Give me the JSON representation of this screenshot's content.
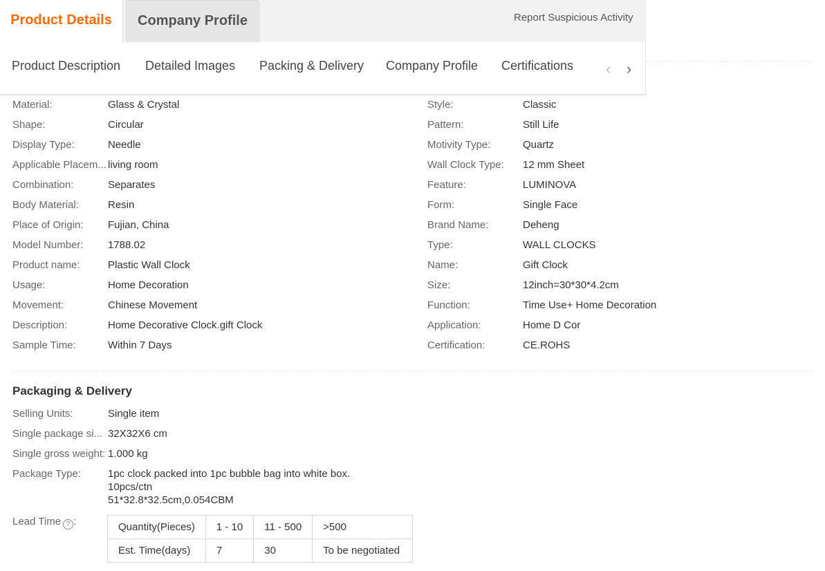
{
  "top_tabs": {
    "active": "Product Details",
    "inactive": "Company Profile",
    "report": "Report Suspicious Activity"
  },
  "subnav": {
    "items": [
      "Product Description",
      "Detailed Images",
      "Packing & Delivery",
      "Company Profile",
      "Certifications"
    ],
    "prev_icon": "chevron-left-icon",
    "next_icon": "chevron-right-icon"
  },
  "attributes_left": [
    {
      "label": "Material:",
      "value": "Glass & Crystal"
    },
    {
      "label": "Shape:",
      "value": "Circular"
    },
    {
      "label": "Display Type:",
      "value": "Needle"
    },
    {
      "label": "Applicable Placem...",
      "value": "living room"
    },
    {
      "label": "Combination:",
      "value": "Separates"
    },
    {
      "label": "Body Material:",
      "value": "Resin"
    },
    {
      "label": "Place of Origin:",
      "value": "Fujian, China"
    },
    {
      "label": "Model Number:",
      "value": "1788.02"
    },
    {
      "label": "Product name:",
      "value": "Plastic Wall Clock"
    },
    {
      "label": "Usage:",
      "value": "Home Decoration"
    },
    {
      "label": "Movement:",
      "value": "Chinese Movement"
    },
    {
      "label": "Description:",
      "value": "Home Decorative Clock.gift Clock"
    },
    {
      "label": "Sample Time:",
      "value": "Within 7 Days"
    }
  ],
  "attributes_right": [
    {
      "label": "Style:",
      "value": "Classic"
    },
    {
      "label": "Pattern:",
      "value": "Still Life"
    },
    {
      "label": "Motivity Type:",
      "value": "Quartz"
    },
    {
      "label": "Wall Clock Type:",
      "value": "12 mm Sheet"
    },
    {
      "label": "Feature:",
      "value": "LUMINOVA"
    },
    {
      "label": "Form:",
      "value": "Single Face"
    },
    {
      "label": "Brand Name:",
      "value": "Deheng"
    },
    {
      "label": "Type:",
      "value": "WALL CLOCKS"
    },
    {
      "label": "Name:",
      "value": "Gift Clock"
    },
    {
      "label": "Size:",
      "value": "12inch=30*30*4.2cm"
    },
    {
      "label": "Function:",
      "value": "Time Use+ Home Decoration"
    },
    {
      "label": "Application:",
      "value": "Home D Cor"
    },
    {
      "label": "Certification:",
      "value": "CE.ROHS"
    }
  ],
  "packaging": {
    "title": "Packaging & Delivery",
    "rows": [
      {
        "label": "Selling Units:",
        "value": "Single item"
      },
      {
        "label": "Single package si...",
        "value": "32X32X6 cm"
      },
      {
        "label": "Single gross weight:",
        "value": "1.000 kg"
      }
    ],
    "package_type_label": "Package Type:",
    "package_type_lines": [
      "1pc clock packed into 1pc bubble bag into white box.",
      "10pcs/ctn",
      "51*32.8*32.5cm,0.054CBM"
    ],
    "lead_time_label": "Lead Time",
    "lead_time_suffix": ":",
    "help_icon": "question-circle-icon",
    "help_glyph": "?",
    "lead_table": [
      [
        "Quantity(Pieces)",
        "1 - 10",
        "11 - 500",
        ">500"
      ],
      [
        "Est. Time(days)",
        "7",
        "30",
        "To be negotiated"
      ]
    ]
  }
}
